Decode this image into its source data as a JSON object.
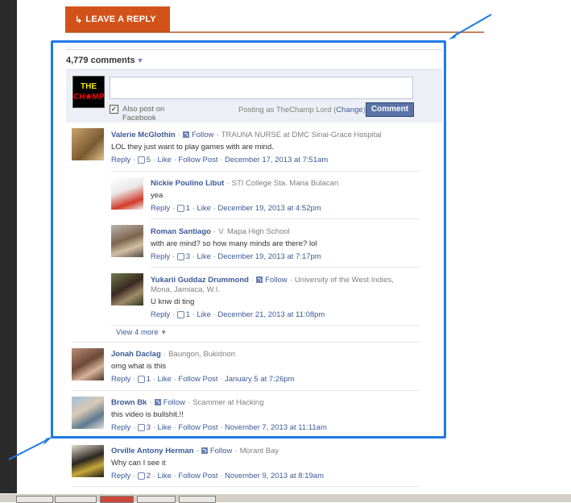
{
  "reply_tab": {
    "label": "LEAVE A REPLY",
    "icon": "reply-arrow-icon",
    "color": "#d2521a"
  },
  "comments": {
    "count_label": "4,779 comments",
    "composer": {
      "logo_line1": "THE",
      "logo_line2": "CH★MP",
      "also_post": "Also post on Facebook",
      "posting_as": "Posting as TheChamp Lord",
      "change_label": "Change",
      "button_label": "Comment"
    },
    "items": [
      {
        "name": "Valerie McGlothin",
        "follow": "Follow",
        "meta": "TRAUNA NURSE at DMC Sinai-Grace Hospital",
        "text": "LOL they just want to play games with are mind.",
        "reply": "Reply",
        "likes": "5",
        "like": "Like",
        "follow_post": "Follow Post",
        "time": "December 17, 2013 at 7:51am"
      },
      {
        "name": "Nickie Poulino Libut",
        "meta": "STI College Sta. Maria Bulacan",
        "text": "yea",
        "reply": "Reply",
        "likes": "1",
        "like": "Like",
        "time": "December 19, 2013 at 4:52pm"
      },
      {
        "name": "Roman Santiago",
        "meta": "V. Mapa High School",
        "text": "with are mind? so how many minds are there? lol",
        "reply": "Reply",
        "likes": "3",
        "like": "Like",
        "time": "December 19, 2013 at 7:17pm"
      },
      {
        "name": "Yukarii Guddaz Drummond",
        "follow": "Follow",
        "meta": "University of the West Indies,",
        "meta2": "Mona, Jamiaca, W.I.",
        "text": "U knw di ting",
        "reply": "Reply",
        "likes": "1",
        "like": "Like",
        "time": "December 21, 2013 at 11:08pm"
      },
      {
        "name": "Jonah Daclag",
        "meta": "Baungon, Bukidnon",
        "text": "omg what is this",
        "reply": "Reply",
        "likes": "1",
        "like": "Like",
        "follow_post": "Follow Post",
        "time": "January 5 at 7:26pm"
      },
      {
        "name": "Brown Bk",
        "follow": "Follow",
        "meta": "Scammer at Hacking",
        "text": "this video is bullshit.!!",
        "reply": "Reply",
        "likes": "3",
        "like": "Like",
        "follow_post": "Follow Post",
        "time": "November 7, 2013 at 11:11am"
      },
      {
        "name": "Orville Antony Herman",
        "follow": "Follow",
        "meta": "Morant Bay",
        "text": "Why can I see it",
        "reply": "Reply",
        "likes": "2",
        "like": "Like",
        "follow_post": "Follow Post",
        "time": "November 9, 2013 at 8:19am"
      }
    ],
    "view_more": "View 4 more"
  },
  "colors": {
    "highlight": "#1e7ae6",
    "link": "#3b5998",
    "button": "#5b74a8"
  }
}
